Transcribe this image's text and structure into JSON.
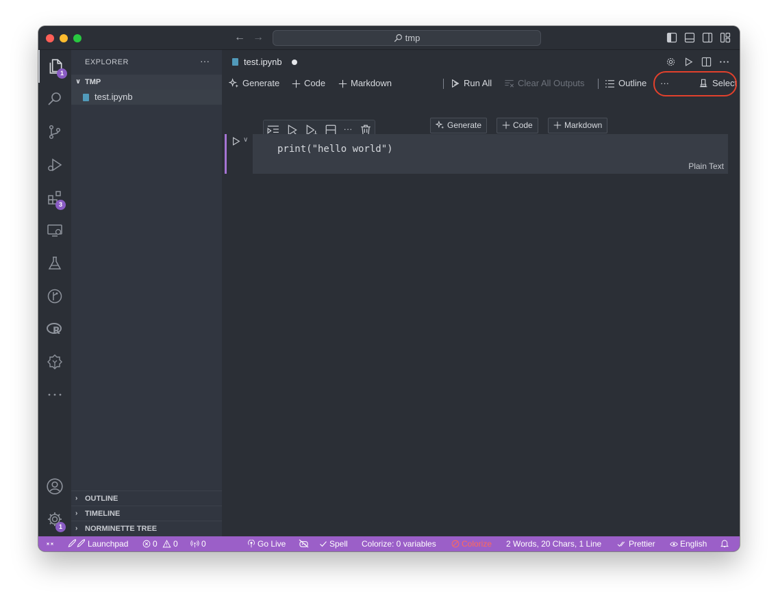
{
  "titlebar": {
    "search_text": "tmp"
  },
  "activity_bar": {
    "explorer_badge": "1",
    "extensions_badge": "3",
    "settings_badge": "1"
  },
  "sidebar": {
    "title": "EXPLORER",
    "folder": "TMP",
    "file": "test.ipynb",
    "sections": [
      "OUTLINE",
      "TIMELINE",
      "NORMINETTE TREE"
    ]
  },
  "editor": {
    "tab_label": "test.ipynb",
    "toolbar": {
      "generate": "Generate",
      "code": "Code",
      "markdown": "Markdown",
      "run_all": "Run All",
      "clear_outputs": "Clear All Outputs",
      "outline": "Outline",
      "more": "···",
      "select_kernel": "Select Kernel"
    },
    "cell": {
      "source": "print(\"hello world\")",
      "language": "Plain Text",
      "more": "···"
    },
    "insert": {
      "generate": "Generate",
      "code": "Code",
      "markdown": "Markdown"
    }
  },
  "statusbar": {
    "launchpad": "Launchpad",
    "errors": "0",
    "warnings": "0",
    "ports": "0",
    "go_live": "Go Live",
    "spell": "Spell",
    "colorize_vars": "Colorize: 0 variables",
    "colorize": "Colorize",
    "counts": "2 Words, 20 Chars, 1 Line",
    "prettier": "Prettier",
    "language": "English"
  },
  "colors": {
    "statusbar_bg": "#9b5fc8",
    "badge": "#8a5cc4",
    "highlight_ring": "#e3412c",
    "cell_bar": "#a574d4"
  }
}
